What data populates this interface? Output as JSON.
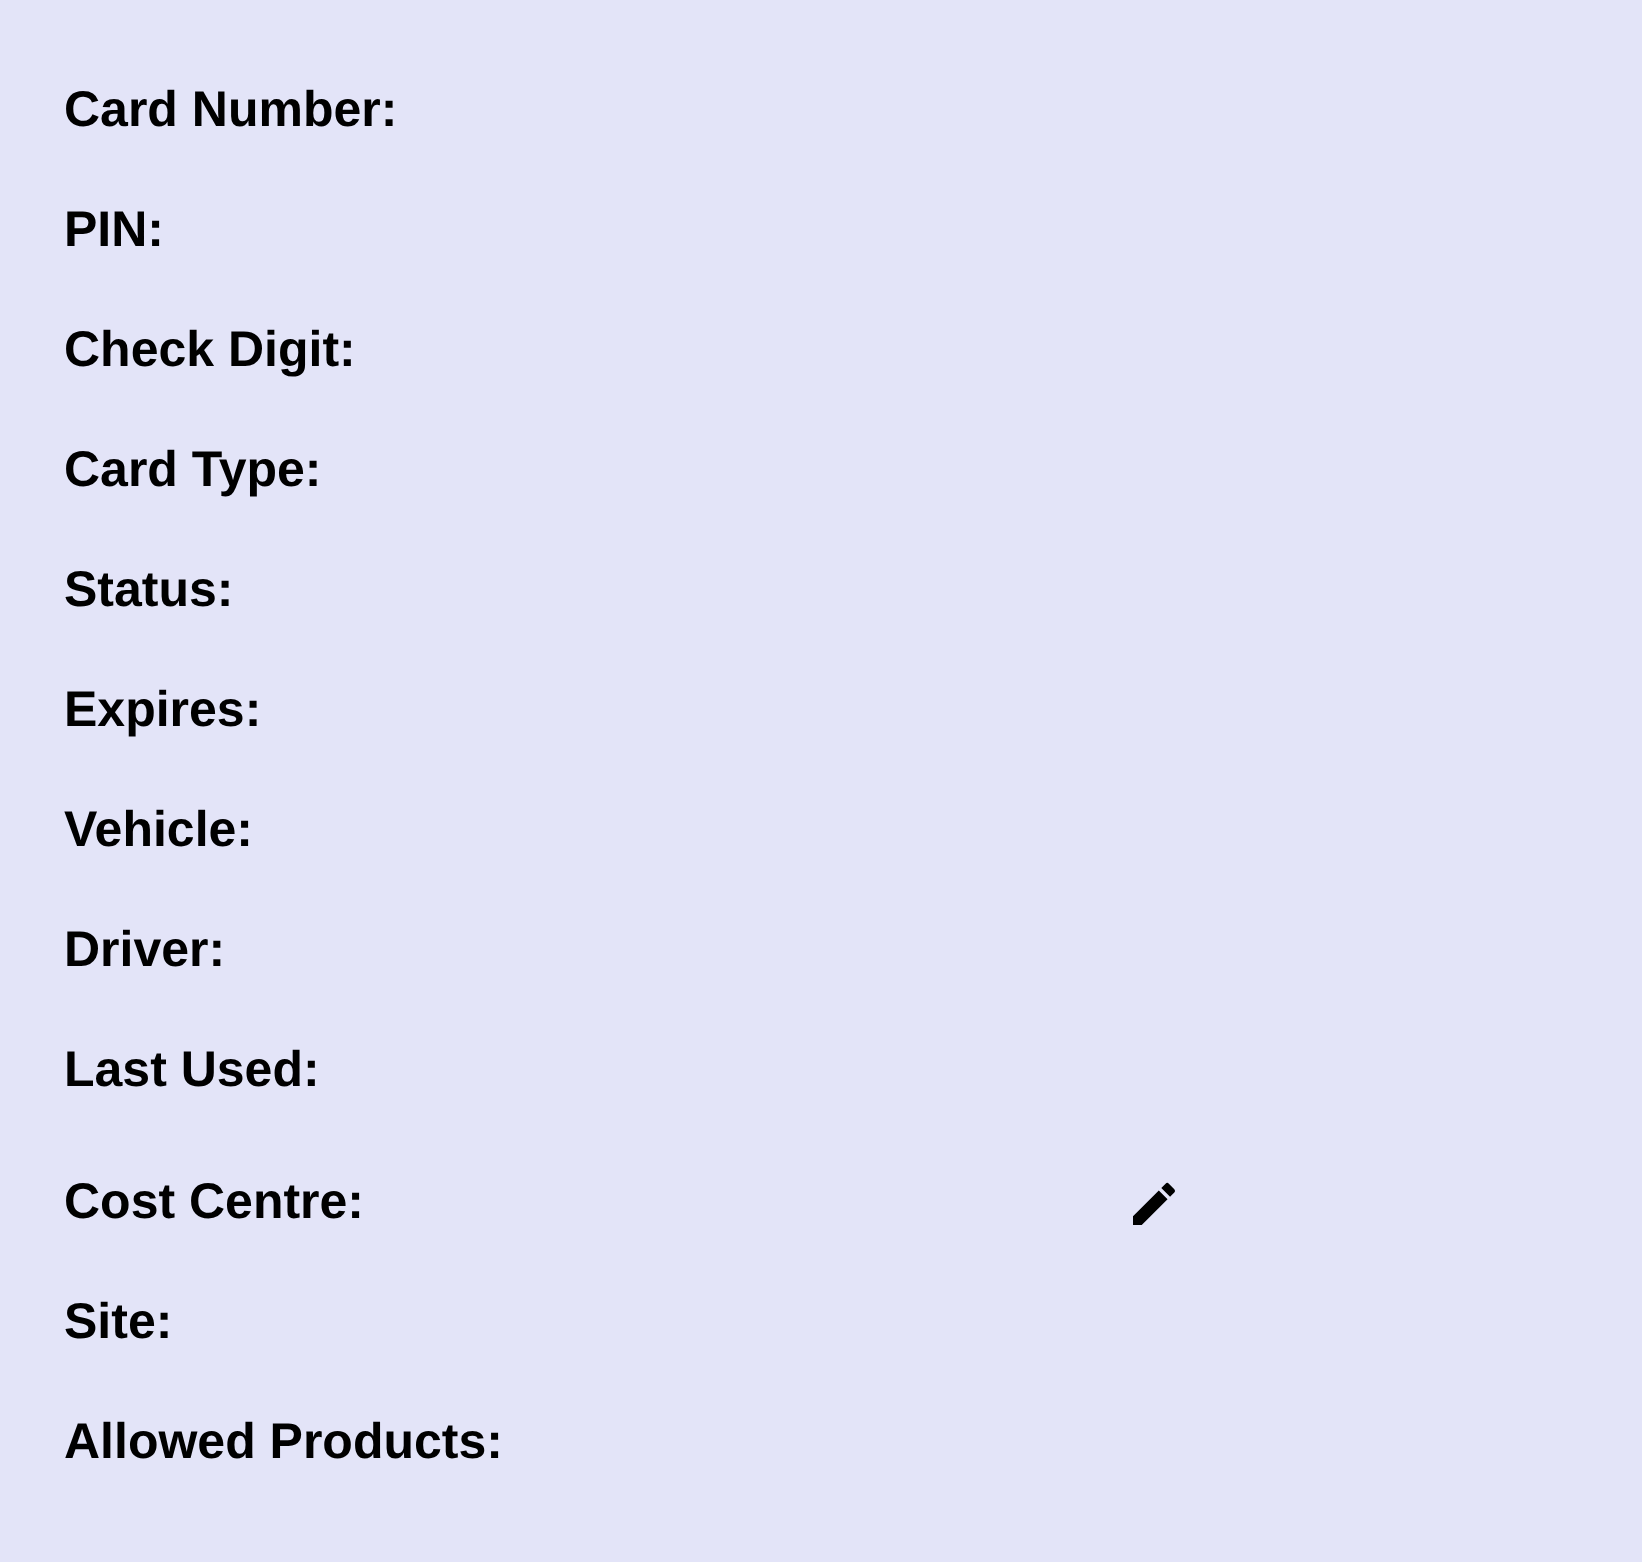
{
  "fields": [
    {
      "label": "Card Number:",
      "kind": "plain"
    },
    {
      "label": "PIN:",
      "kind": "plain"
    },
    {
      "label": "Check Digit:",
      "kind": "plain"
    },
    {
      "label": "Card Type:",
      "kind": "plain"
    },
    {
      "label": "Status:",
      "kind": "plain"
    },
    {
      "label": "Expires:",
      "kind": "plain"
    },
    {
      "label": "Vehicle:",
      "kind": "plain"
    },
    {
      "label": "Driver:",
      "kind": "plain"
    },
    {
      "label": "Last Used:",
      "kind": "plain"
    },
    {
      "label": "Cost Centre:",
      "kind": "editable"
    },
    {
      "label": "Site:",
      "kind": "plain"
    },
    {
      "label": "Allowed Products:",
      "kind": "plain"
    }
  ]
}
